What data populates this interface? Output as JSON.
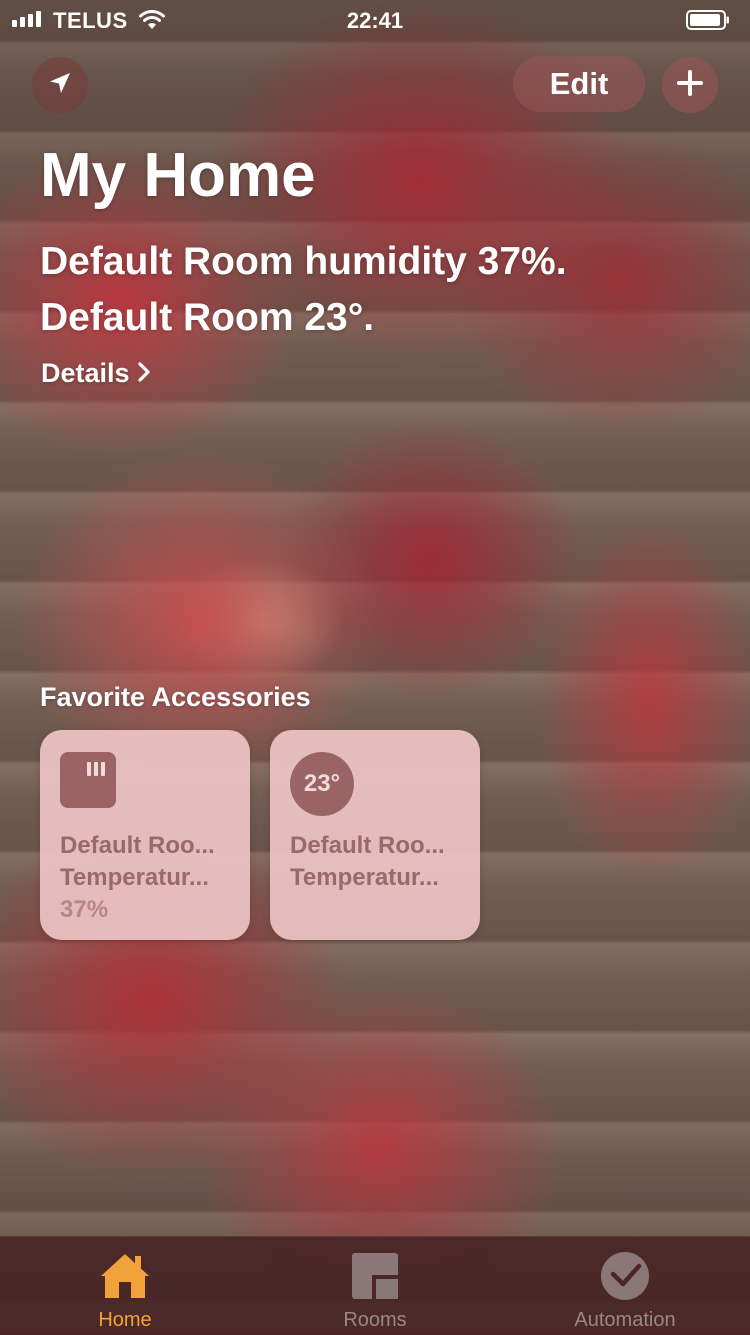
{
  "status_bar": {
    "carrier": "TELUS",
    "time": "22:41"
  },
  "header": {
    "edit_label": "Edit",
    "title": "My Home"
  },
  "summary": {
    "line1": "Default Room humidity 37%.",
    "line2": "Default Room 23°."
  },
  "details_label": "Details",
  "favorites": {
    "section_title": "Favorite Accessories",
    "tiles": [
      {
        "icon": "humidity-sensor-icon",
        "name": "Default Roo...",
        "type": "Temperatur...",
        "value": "37%"
      },
      {
        "icon_value": "23°",
        "name": "Default Roo...",
        "type": "Temperatur..."
      }
    ]
  },
  "tabs": [
    {
      "label": "Home",
      "icon": "house-icon",
      "active": true
    },
    {
      "label": "Rooms",
      "icon": "rooms-icon",
      "active": false
    },
    {
      "label": "Automation",
      "icon": "clock-check-icon",
      "active": false
    }
  ],
  "colors": {
    "accent": "#f2a23a",
    "tile_background": "#ecc4c4",
    "tile_icon": "#9a6464"
  }
}
